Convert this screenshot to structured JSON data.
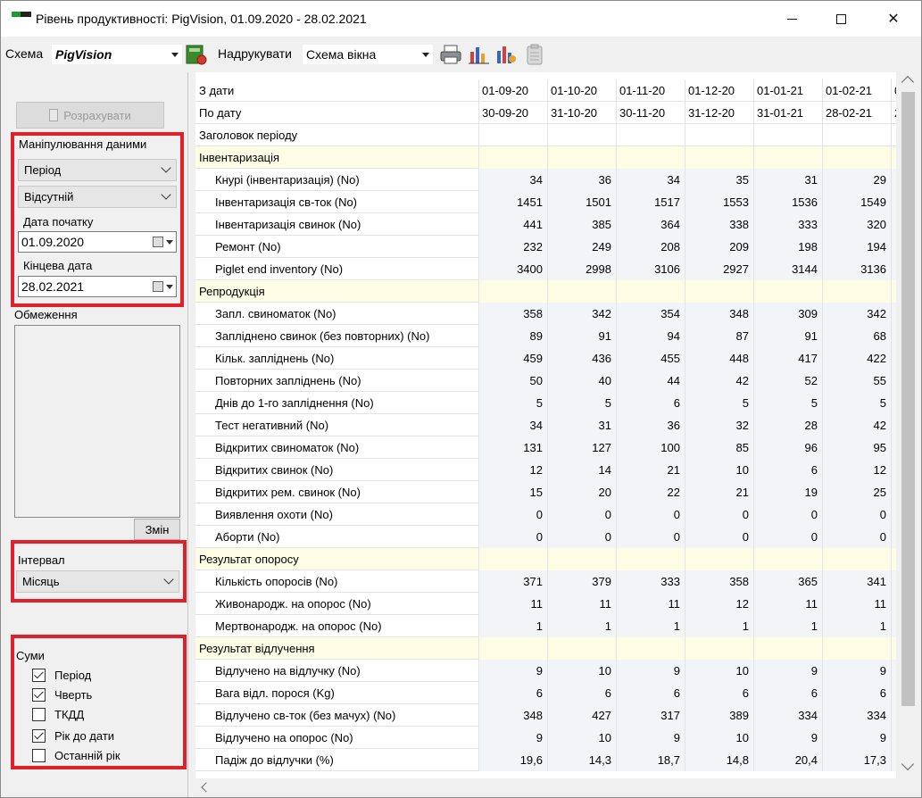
{
  "window": {
    "title": "Рівень продуктивності: PigVision, 01.09.2020 - 28.02.2021",
    "minimize": "",
    "maximize": "",
    "close": "✕"
  },
  "toolbar": {
    "schema_label": "Схема",
    "schema_value": "PigVision",
    "print_label": "Надрукувати",
    "window_schema_value": "Схема вікна"
  },
  "left": {
    "calculate_label": "Розрахувати",
    "data_manip_label": "Маніпулювання даними",
    "period_select": "Період",
    "absent_select": "Відсутній",
    "start_date_label": "Дата початку",
    "start_date_value": "01.09.2020",
    "end_date_label": "Кінцева дата",
    "end_date_value": "28.02.2021",
    "restrictions_label": "Обмеження",
    "change_button": "Змін",
    "interval_label": "Інтервал",
    "interval_value": "Місяць",
    "sums_label": "Суми",
    "sums": [
      {
        "label": "Період",
        "checked": true
      },
      {
        "label": "Чверть",
        "checked": true
      },
      {
        "label": "ТКДД",
        "checked": false
      },
      {
        "label": "Рік до дати",
        "checked": true
      },
      {
        "label": "Останній рік",
        "checked": false
      }
    ]
  },
  "grid": {
    "rows": [
      {
        "type": "header",
        "label": "З дати",
        "values": [
          "01-09-20",
          "01-10-20",
          "01-11-20",
          "01-12-20",
          "01-01-21",
          "01-02-21",
          "0"
        ]
      },
      {
        "type": "header",
        "label": "По дату",
        "values": [
          "30-09-20",
          "31-10-20",
          "30-11-20",
          "31-12-20",
          "31-01-21",
          "28-02-21",
          "2"
        ]
      },
      {
        "type": "header",
        "label": "Заголовок періоду",
        "values": [
          "",
          "",
          "",
          "",
          "",
          "",
          ""
        ]
      },
      {
        "type": "category",
        "label": "Інвентаризація",
        "values": [
          "",
          "",
          "",
          "",
          "",
          "",
          ""
        ]
      },
      {
        "type": "data",
        "label": "Кнурі (інвентаризація) (No)",
        "values": [
          "34",
          "36",
          "34",
          "35",
          "31",
          "29",
          ""
        ]
      },
      {
        "type": "data",
        "label": "Інвентаризація св-ток (No)",
        "values": [
          "1451",
          "1501",
          "1517",
          "1553",
          "1536",
          "1549",
          ""
        ]
      },
      {
        "type": "data",
        "label": "Інвентаризація свинок (No)",
        "values": [
          "441",
          "385",
          "364",
          "338",
          "333",
          "320",
          ""
        ]
      },
      {
        "type": "data",
        "label": "Ремонт (No)",
        "values": [
          "232",
          "249",
          "208",
          "209",
          "198",
          "194",
          ""
        ]
      },
      {
        "type": "data",
        "label": "Piglet end inventory (No)",
        "values": [
          "3400",
          "2998",
          "3106",
          "2927",
          "3144",
          "3136",
          ""
        ]
      },
      {
        "type": "category",
        "label": "Репродукція",
        "values": [
          "",
          "",
          "",
          "",
          "",
          "",
          ""
        ]
      },
      {
        "type": "data",
        "label": "Запл. свиноматок (No)",
        "values": [
          "358",
          "342",
          "354",
          "348",
          "309",
          "342",
          ""
        ]
      },
      {
        "type": "data",
        "label": "Запліднено свинок  (без повторних) (No)",
        "values": [
          "89",
          "91",
          "94",
          "87",
          "91",
          "68",
          ""
        ]
      },
      {
        "type": "data",
        "label": "Кільк. запліднень (No)",
        "values": [
          "459",
          "436",
          "455",
          "448",
          "417",
          "422",
          ""
        ]
      },
      {
        "type": "data",
        "label": "Повторних запліднень (No)",
        "values": [
          "50",
          "40",
          "44",
          "42",
          "52",
          "55",
          ""
        ]
      },
      {
        "type": "data",
        "label": "Днів до 1-го запліднення (No)",
        "values": [
          "5",
          "5",
          "6",
          "5",
          "5",
          "5",
          ""
        ]
      },
      {
        "type": "data",
        "label": "Тест негативний (No)",
        "values": [
          "34",
          "31",
          "36",
          "32",
          "28",
          "42",
          ""
        ]
      },
      {
        "type": "data",
        "label": "Відкритих свиноматок (No)",
        "values": [
          "131",
          "127",
          "100",
          "85",
          "96",
          "95",
          ""
        ]
      },
      {
        "type": "data",
        "label": "Відкритих свинок (No)",
        "values": [
          "12",
          "14",
          "21",
          "10",
          "6",
          "12",
          ""
        ]
      },
      {
        "type": "data",
        "label": "Відкритих рем. свинок (No)",
        "values": [
          "15",
          "20",
          "22",
          "21",
          "19",
          "25",
          ""
        ]
      },
      {
        "type": "data",
        "label": "Виявлення охоти (No)",
        "values": [
          "0",
          "0",
          "0",
          "0",
          "0",
          "0",
          ""
        ]
      },
      {
        "type": "data",
        "label": "Аборти (No)",
        "values": [
          "0",
          "0",
          "0",
          "0",
          "0",
          "0",
          ""
        ]
      },
      {
        "type": "category",
        "label": "Результат опоросу",
        "values": [
          "",
          "",
          "",
          "",
          "",
          "",
          ""
        ]
      },
      {
        "type": "data",
        "label": "Кількість опоросів (No)",
        "values": [
          "371",
          "379",
          "333",
          "358",
          "365",
          "341",
          ""
        ]
      },
      {
        "type": "data",
        "label": "Живонародж. на опорос (No)",
        "values": [
          "11",
          "11",
          "11",
          "12",
          "11",
          "11",
          ""
        ]
      },
      {
        "type": "data",
        "label": "Мертвонародж. на опорос (No)",
        "values": [
          "1",
          "1",
          "1",
          "1",
          "1",
          "1",
          ""
        ]
      },
      {
        "type": "category",
        "label": "Результат відлучення",
        "values": [
          "",
          "",
          "",
          "",
          "",
          "",
          ""
        ]
      },
      {
        "type": "data",
        "label": "Відлучено на відлучку (No)",
        "values": [
          "9",
          "10",
          "9",
          "10",
          "9",
          "9",
          ""
        ]
      },
      {
        "type": "data",
        "label": "Вага відл. порося (Kg)",
        "values": [
          "6",
          "6",
          "6",
          "6",
          "6",
          "6",
          ""
        ]
      },
      {
        "type": "data",
        "label": "Відлучено св-ток (без мачух) (No)",
        "values": [
          "348",
          "427",
          "317",
          "389",
          "334",
          "334",
          ""
        ]
      },
      {
        "type": "data",
        "label": "Відлучено на опорос (No)",
        "values": [
          "9",
          "10",
          "9",
          "10",
          "9",
          "9",
          ""
        ]
      },
      {
        "type": "data",
        "label": "Падіж до відлучки (%)",
        "values": [
          "19,6",
          "14,3",
          "18,7",
          "14,8",
          "20,4",
          "17,3",
          ""
        ]
      }
    ]
  }
}
